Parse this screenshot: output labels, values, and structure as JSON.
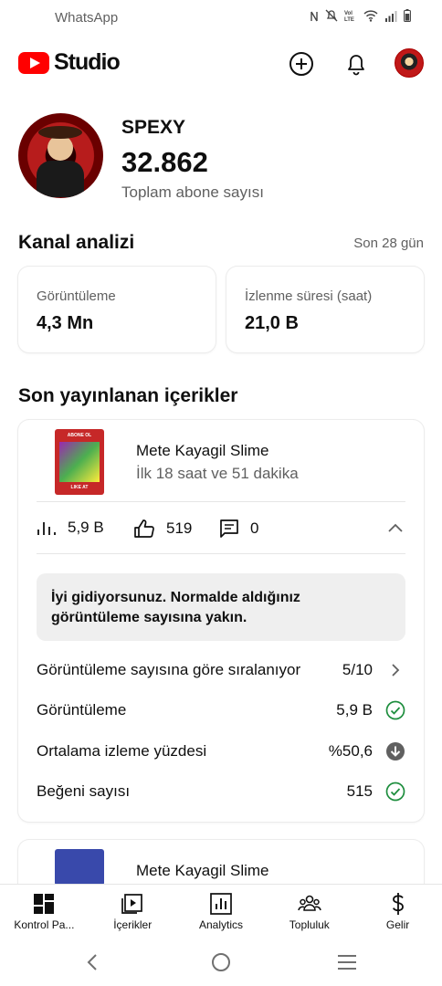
{
  "status_bar": {
    "app_name": "WhatsApp",
    "icons": [
      "nfc-icon",
      "mute-icon",
      "volte-icon",
      "wifi-icon",
      "signal-icon",
      "battery-icon"
    ]
  },
  "header": {
    "logo_text": "Studio",
    "brand_color": "#ff0000",
    "actions": [
      "create-icon",
      "notifications-icon",
      "account-avatar"
    ]
  },
  "channel": {
    "name": "SPEXY",
    "subscriber_count": "32.862",
    "subscriber_label": "Toplam abone sayısı"
  },
  "analytics": {
    "title": "Kanal analizi",
    "period": "Son 28 gün",
    "cards": [
      {
        "label": "Görüntüleme",
        "value": "4,3 Mn"
      },
      {
        "label": "İzlenme süresi (saat)",
        "value": "21,0 B"
      }
    ]
  },
  "latest_content": {
    "title": "Son yayınlanan içerikler",
    "items": [
      {
        "title": "Mete Kayagil Slime",
        "subtitle": "İlk 18 saat ve 51 dakika",
        "thumb_top": "ABONE OL",
        "thumb_bottom": "LIKE AT",
        "views": "5,9 B",
        "likes": "519",
        "comments": "0",
        "tip": "İyi gidiyorsunuz. Normalde aldığınız görüntüleme sayısına yakın.",
        "rows": [
          {
            "label": "Görüntüleme sayısına göre sıralanıyor",
            "value": "5/10",
            "icon": "chevron-right-icon"
          },
          {
            "label": "Görüntüleme",
            "value": "5,9 B",
            "icon": "check-circle-icon"
          },
          {
            "label": "Ortalama izleme yüzdesi",
            "value": "%50,6",
            "icon": "arrow-down-circle-icon"
          },
          {
            "label": "Beğeni sayısı",
            "value": "515",
            "icon": "check-circle-icon"
          }
        ]
      },
      {
        "title": "Mete Kayagil Slime"
      }
    ]
  },
  "bottom_nav": [
    {
      "label": "Kontrol Pa...",
      "icon": "dashboard-icon"
    },
    {
      "label": "İçerikler",
      "icon": "content-icon"
    },
    {
      "label": "Analytics",
      "icon": "analytics-icon"
    },
    {
      "label": "Topluluk",
      "icon": "community-icon"
    },
    {
      "label": "Gelir",
      "icon": "earn-icon"
    }
  ],
  "colors": {
    "success": "#1e8e3e",
    "neutral": "#606060"
  }
}
